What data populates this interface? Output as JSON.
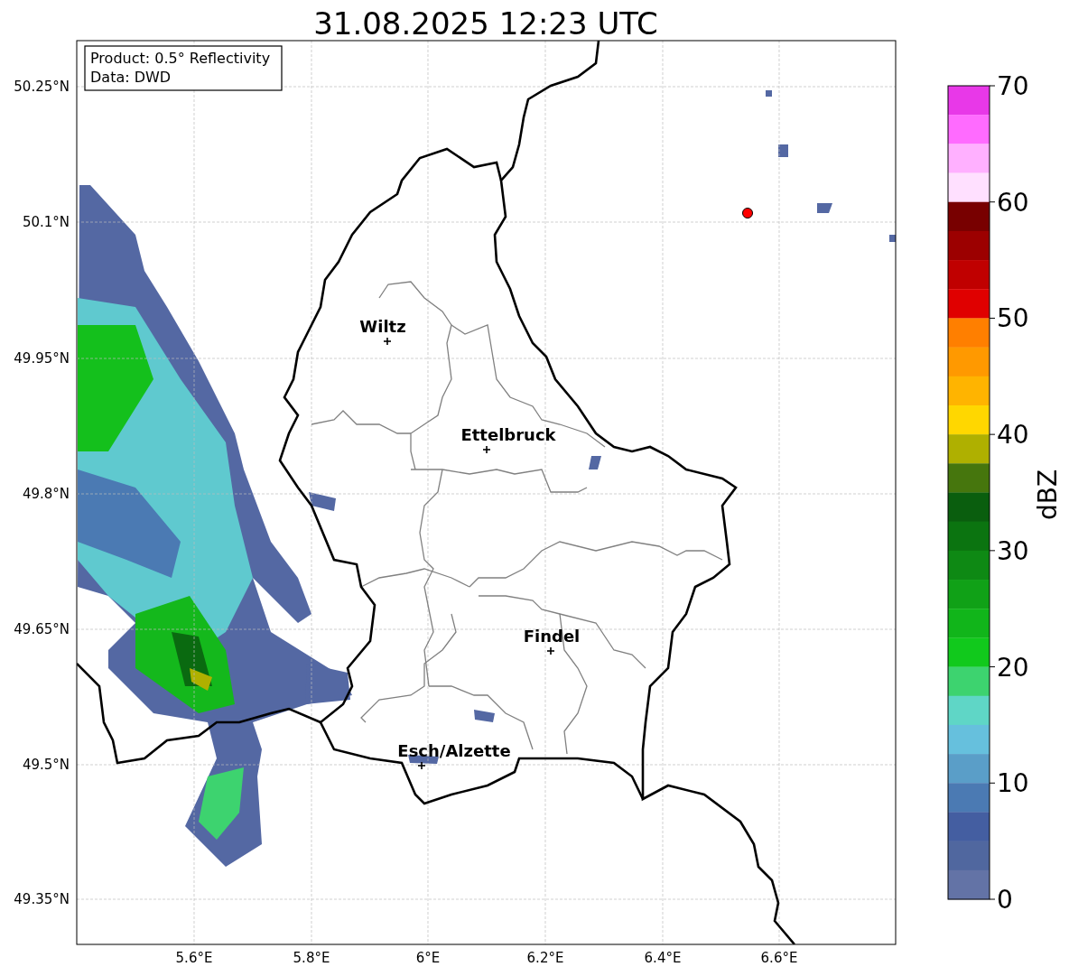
{
  "title": "31.08.2025 12:23 UTC",
  "info_box": {
    "lines": [
      "Product: 0.5° Reflectivity",
      "Data: DWD"
    ]
  },
  "map": {
    "lat_labels": [
      "50.25°N",
      "50.1°N",
      "49.95°N",
      "49.8°N",
      "49.65°N",
      "49.5°N",
      "49.35°N"
    ],
    "lon_labels": [
      "5.6°E",
      "5.8°E",
      "6°E",
      "6.2°E",
      "6.4°E",
      "6.6°E"
    ],
    "cities": [
      "Wiltz",
      "Ettelbruck",
      "Findel",
      "Esch/Alzette"
    ]
  },
  "colorbar": {
    "label": "dBZ",
    "ticks": [
      "70",
      "60",
      "50",
      "40",
      "30",
      "20",
      "10",
      "0"
    ],
    "bins": [
      {
        "color": "#e838e8"
      },
      {
        "color": "#ff6bff"
      },
      {
        "color": "#ffb0ff"
      },
      {
        "color": "#ffe0ff"
      },
      {
        "color": "#780000"
      },
      {
        "color": "#9c0000"
      },
      {
        "color": "#c00000"
      },
      {
        "color": "#e00000"
      },
      {
        "color": "#ff7f00"
      },
      {
        "color": "#ff9900"
      },
      {
        "color": "#ffb400"
      },
      {
        "color": "#ffd700"
      },
      {
        "color": "#afb000"
      },
      {
        "color": "#46760d"
      },
      {
        "color": "#0a5e0e"
      },
      {
        "color": "#0b7410"
      },
      {
        "color": "#0e8914"
      },
      {
        "color": "#10a117"
      },
      {
        "color": "#11b51a"
      },
      {
        "color": "#11c91c"
      },
      {
        "color": "#3dd36f"
      },
      {
        "color": "#5fd6c6"
      },
      {
        "color": "#66c0dd"
      },
      {
        "color": "#5a9ec8"
      },
      {
        "color": "#4b7ab3"
      },
      {
        "color": "#445ea1"
      },
      {
        "color": "#50679f"
      },
      {
        "color": "#6373a6"
      }
    ]
  }
}
